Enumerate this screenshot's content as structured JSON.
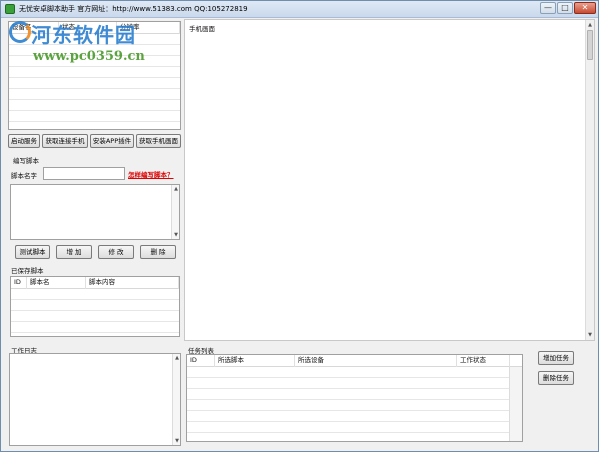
{
  "window": {
    "title": "无忧安卓脚本助手  官方网址：http://www.51383.com  QQ:105272819",
    "minimize": "—",
    "maximize": "□",
    "close": "✕"
  },
  "watermark": {
    "line1": "河东软件园",
    "line2": "www.pc0359.cn"
  },
  "devices_table": {
    "columns": [
      "设备名",
      "状态",
      "分辨率"
    ]
  },
  "screen_panel": {
    "label": "手机画面"
  },
  "device_buttons": {
    "start_service": "启动服务",
    "get_phone": "获取连接手机",
    "install_app": "安装APP插件",
    "get_screen": "获取手机画面"
  },
  "script_editor": {
    "group_label": "编写脚本",
    "name_label": "脚本名字",
    "name_value": "",
    "howto_link": "怎样编写脚本？",
    "test_button": "测试脚本",
    "add_button": "增 加",
    "modify_button": "修 改",
    "delete_button": "删 除"
  },
  "saved_scripts": {
    "label": "已保存脚本",
    "columns": [
      "ID",
      "脚本名",
      "脚本内容"
    ]
  },
  "work_log": {
    "label": "工作日志"
  },
  "tasks": {
    "label": "任务列表",
    "columns": [
      "ID",
      "所选脚本",
      "所选设备",
      "工作状态"
    ],
    "add_button": "增加任务",
    "delete_button": "删除任务"
  },
  "colors": {
    "link": "#dd0000",
    "titlebar": "#c9d9ec",
    "watermark_blue": "#2b7fd0",
    "watermark_green": "#4a9a2a"
  }
}
